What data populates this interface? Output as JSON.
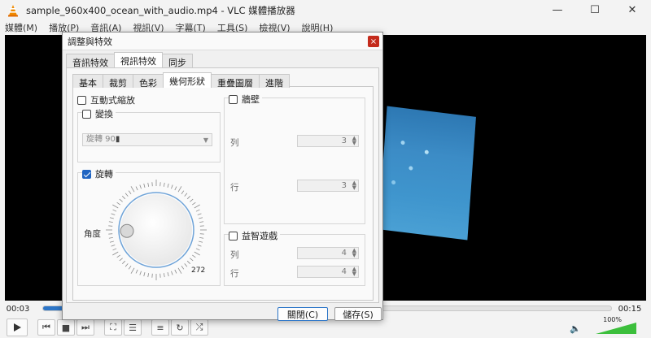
{
  "window": {
    "title": "sample_960x400_ocean_with_audio.mp4 - VLC 媒體播放器",
    "controls": {
      "minimize": "—",
      "maximize": "☐",
      "close": "✕"
    }
  },
  "menu": [
    "媒體(M)",
    "播放(P)",
    "音訊(A)",
    "視訊(V)",
    "字幕(T)",
    "工具(S)",
    "檢視(V)",
    "說明(H)"
  ],
  "player": {
    "elapsed": "00:03",
    "total": "00:15",
    "progress_pct": 20,
    "volume_label": "100%",
    "volume_pct": 100
  },
  "dialog": {
    "title": "調整與特效",
    "close_glyph": "×",
    "top_tabs": [
      "音訊特效",
      "視訊特效",
      "同步"
    ],
    "active_top_tab": 1,
    "sub_tabs": [
      "基本",
      "裁剪",
      "色彩",
      "幾何形狀",
      "重疊圖層",
      "進階"
    ],
    "active_sub_tab": 3,
    "interactive_zoom": {
      "label": "互動式縮放",
      "checked": false
    },
    "transform": {
      "label": "變換",
      "checked": false,
      "select_value": "旋轉 90",
      "select_arrow": "▼"
    },
    "rotate": {
      "label": "旋轉",
      "checked": true,
      "angle_label": "角度",
      "angle_value": "272",
      "angle_degrees": 272
    },
    "wall": {
      "label": "牆壁",
      "checked": false,
      "rows_label": "列",
      "rows_value": "3",
      "cols_label": "行",
      "cols_value": "3"
    },
    "puzzle": {
      "label": "益智遊戲",
      "checked": false,
      "rows_label": "列",
      "rows_value": "4",
      "cols_label": "行",
      "cols_value": "4"
    },
    "close_button": "關閉(C)",
    "save_button": "儲存(S)"
  }
}
